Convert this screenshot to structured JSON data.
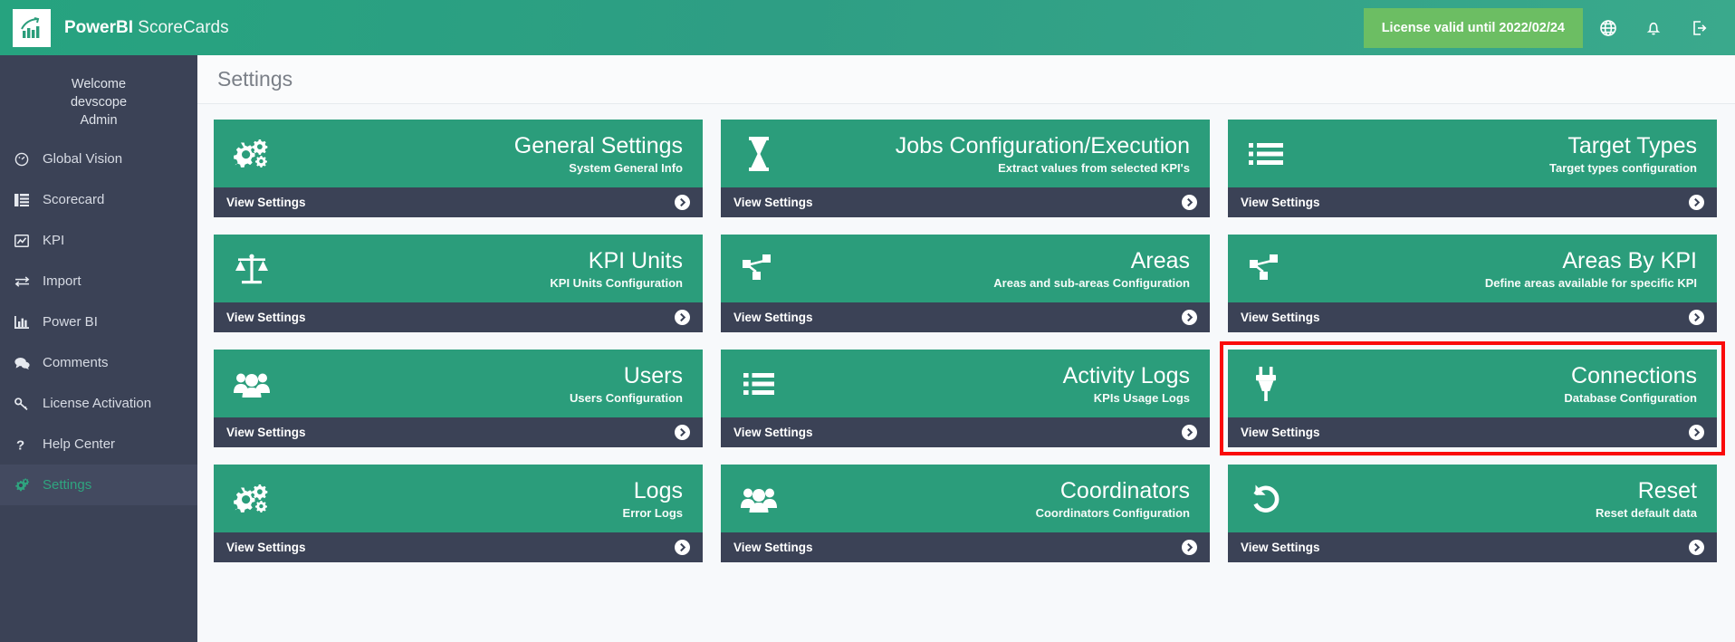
{
  "header": {
    "logo_icon": "bar-chart-logo-icon",
    "brand_bold": "PowerBI",
    "brand_light": " ScoreCards",
    "menu_icon": "hamburger-menu-icon",
    "license_label": "License valid until 2022/02/24",
    "globe_icon": "globe-icon",
    "bell_icon": "bell-icon",
    "logout_icon": "logout-icon"
  },
  "sidebar": {
    "welcome_line1": "Welcome",
    "welcome_line2": "devscope",
    "welcome_line3": "Admin",
    "items": [
      {
        "label": "Global Vision",
        "icon": "gauge-icon",
        "active": false
      },
      {
        "label": "Scorecard",
        "icon": "table-icon",
        "active": false
      },
      {
        "label": "KPI",
        "icon": "chart-line-icon",
        "active": false
      },
      {
        "label": "Import",
        "icon": "exchange-arrows-icon",
        "active": false
      },
      {
        "label": "Power BI",
        "icon": "bar-chart-icon",
        "active": false
      },
      {
        "label": "Comments",
        "icon": "comments-icon",
        "active": false
      },
      {
        "label": "License Activation",
        "icon": "key-icon",
        "active": false
      },
      {
        "label": "Help Center",
        "icon": "question-mark-icon",
        "active": false
      },
      {
        "label": "Settings",
        "icon": "gears-icon",
        "active": true
      }
    ]
  },
  "main": {
    "page_title": "Settings",
    "view_settings_label": "View Settings",
    "arrow_icon": "chevron-right-circle-icon",
    "cards": [
      [
        {
          "title": "General Settings",
          "subtitle": "System General Info",
          "icon": "gears-icon",
          "highlighted": false
        },
        {
          "title": "Jobs Configuration/Execution",
          "subtitle": "Extract values from selected KPI's",
          "icon": "hourglass-icon",
          "highlighted": false
        },
        {
          "title": "Target Types",
          "subtitle": "Target types configuration",
          "icon": "list-icon",
          "highlighted": false
        }
      ],
      [
        {
          "title": "KPI Units",
          "subtitle": "KPI Units Configuration",
          "icon": "balance-scale-icon",
          "highlighted": false
        },
        {
          "title": "Areas",
          "subtitle": "Areas and sub-areas Configuration",
          "icon": "sitemap-icon",
          "highlighted": false
        },
        {
          "title": "Areas By KPI",
          "subtitle": "Define areas available for specific KPI",
          "icon": "sitemap-icon",
          "highlighted": false
        }
      ],
      [
        {
          "title": "Users",
          "subtitle": "Users Configuration",
          "icon": "users-icon",
          "highlighted": false
        },
        {
          "title": "Activity Logs",
          "subtitle": "KPIs Usage Logs",
          "icon": "list-icon",
          "highlighted": false
        },
        {
          "title": "Connections",
          "subtitle": "Database Configuration",
          "icon": "plug-icon",
          "highlighted": true
        }
      ],
      [
        {
          "title": "Logs",
          "subtitle": "Error Logs",
          "icon": "gears-icon",
          "highlighted": false
        },
        {
          "title": "Coordinators",
          "subtitle": "Coordinators Configuration",
          "icon": "users-icon",
          "highlighted": false
        },
        {
          "title": "Reset",
          "subtitle": "Reset default data",
          "icon": "undo-icon",
          "highlighted": false
        }
      ]
    ]
  },
  "colors": {
    "brand_green": "#2b9d7b",
    "header_green": "#2e9e84",
    "license_green": "#6cbe63",
    "dark_navy": "#3b4256",
    "highlight_red": "#fa0a0a",
    "page_bg": "#f7f9fb"
  }
}
